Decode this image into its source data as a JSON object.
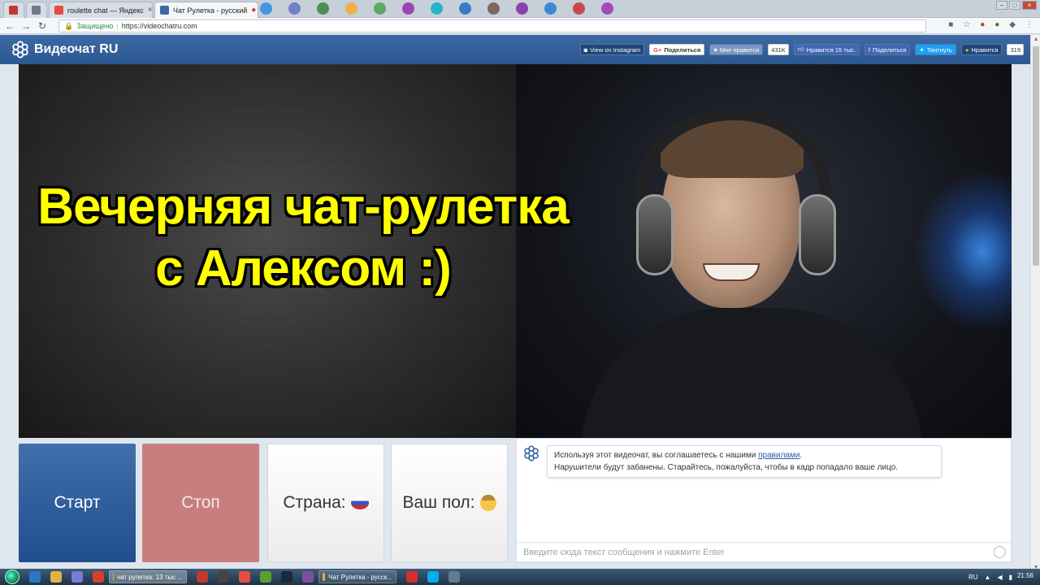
{
  "browser": {
    "tabs": [
      {
        "label": "",
        "fav": "#c0392b"
      },
      {
        "label": "",
        "fav": "#6c7a89"
      },
      {
        "label": "roulette chat — Яндекс",
        "fav": "#e74c3c"
      },
      {
        "label": "Чат Рулетка - русский",
        "fav": "#3b6aa8"
      }
    ],
    "address": {
      "secure_label": "Защищено",
      "url": "https://videochatru.com"
    }
  },
  "site": {
    "logo_text": "Видеочат RU",
    "social": {
      "instagram": "View on Instagram",
      "gplus": "Поделиться",
      "ok_like": "Мне нравится",
      "ok_count": "431K",
      "fb_like": "Нравится 15 тыс.",
      "fb_share": "Поделиться",
      "twitter": "Твитнуть",
      "other_like": "Нравится",
      "other_count": "319"
    }
  },
  "video": {
    "caption_line1": "Вечерняя чат-рулетка",
    "caption_line2": "с Алексом :)"
  },
  "controls": {
    "start": "Старт",
    "stop": "Стоп",
    "country": "Страна:",
    "gender": "Ваш пол:"
  },
  "chat": {
    "notice_prefix": "Используя этот видеочат, вы соглашаетесь с нашими ",
    "notice_link": "правилами",
    "notice_suffix": ".",
    "notice_line2": "Нарушители будут забанены. Старайтесь, пожалуйста, чтобы в кадр попадало ваше лицо.",
    "input_placeholder": "Введите сюда текст сообщения и нажмите Enter"
  },
  "taskbar": {
    "tasks": [
      "чат рулетка: 13 тыс ...",
      "Чат Рулетка - русск..."
    ],
    "lang": "RU",
    "clock": "21:56"
  },
  "colors": {
    "header": "#2c5890",
    "start": "#1f4e8c",
    "stop": "#c97e7e",
    "caption": "#ffff00"
  }
}
